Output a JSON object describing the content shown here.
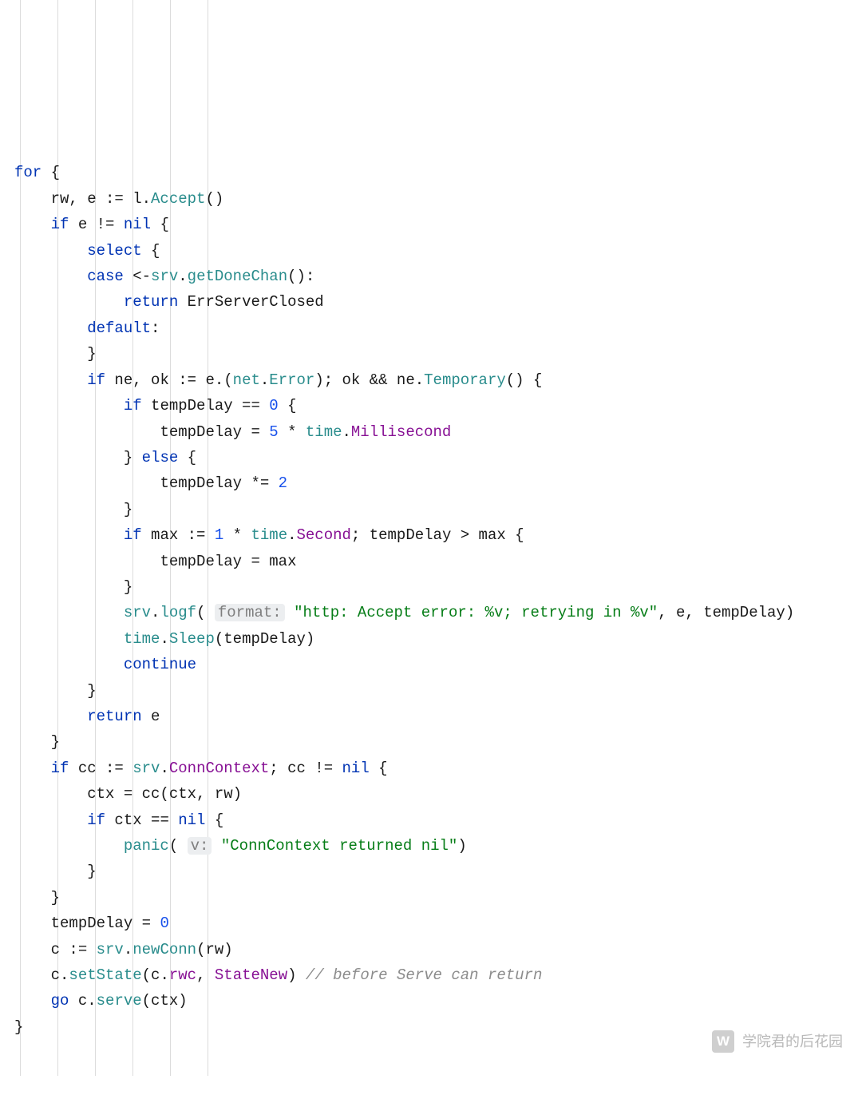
{
  "code": {
    "kw_for": "for",
    "brace_o": " {",
    "l2_rwe": "rw, e := l.",
    "l2_accept": "Accept",
    "l2_end": "()",
    "l3_if": "if",
    "l3_mid": " e != ",
    "l3_nil": "nil",
    "l4_select": "select",
    "l5_case": "case",
    "l5_arrow": " <-",
    "l5_srv": "srv",
    "l5_dot": ".",
    "l5_gdc": "getDoneChan",
    "l5_end": "():",
    "l6_return": "return",
    "l6_val": " ErrServerClosed",
    "l7_default": "default",
    "l7_colon": ":",
    "brace_c": "}",
    "l9_if": "if",
    "l9_neok": " ne, ok := e.(",
    "l9_net": "net",
    "l9_err": "Error",
    "l9_mid": "); ok && ne.",
    "l9_tmp": "Temporary",
    "l9_end": "() {",
    "l10_if": "if",
    "l10_cond": " tempDelay == ",
    "l10_zero": "0",
    "l11_td": "tempDelay = ",
    "l11_five": "5",
    "l11_mul": " * ",
    "l11_time": "time",
    "l11_ms": "Millisecond",
    "l12_else": " else ",
    "else_kw": "else",
    "l13_td": "tempDelay *= ",
    "l13_two": "2",
    "l15_if": "if",
    "l15_mx": " max := ",
    "l15_one": "1",
    "l15_sec": "Second",
    "l15_cond": "; tempDelay > max {",
    "l16_td": "tempDelay = max",
    "l18_srv": "srv",
    "l18_logf": "logf",
    "l18_open": "(",
    "l18_hint": "format:",
    "l18_sp": " ",
    "l18_str": "\"http: Accept error: %v; retrying in %v\"",
    "l18_end": ", e, tempDelay)",
    "l19_time": "time",
    "l19_sleep": "Sleep",
    "l19_end": "(tempDelay)",
    "l20_cont": "continue",
    "l22_return": "return",
    "l22_e": " e",
    "l24_if": "if",
    "l24_cc": " cc := ",
    "l24_srv": "srv",
    "l24_ccx": "ConnContext",
    "l24_mid": "; cc != ",
    "l24_nil": "nil",
    "l25_body": "ctx = cc(ctx, rw)",
    "l26_if": "if",
    "l26_cond": " ctx == ",
    "l26_nil": "nil",
    "l27_panic": "panic",
    "l27_open": "(",
    "l27_hint": "v:",
    "l27_str": "\"ConnContext returned nil\"",
    "l27_end": ")",
    "l30_td": "tempDelay = ",
    "l30_zero": "0",
    "l31_c": "c := ",
    "l31_srv": "srv",
    "l31_nc": "newConn",
    "l31_end": "(rw)",
    "l32_c": "c.",
    "l32_ss": "setState",
    "l32_open": "(c.",
    "l32_rwc": "rwc",
    "l32_comma": ", ",
    "l32_sn": "StateNew",
    "l32_close": ") ",
    "l32_cmt": "// before Serve can return",
    "l33_go": "go",
    "l33_c": " c.",
    "l33_serve": "serve",
    "l33_end": "(ctx)"
  },
  "watermark": {
    "icon_text": "W",
    "label": "学院君的后花园"
  }
}
